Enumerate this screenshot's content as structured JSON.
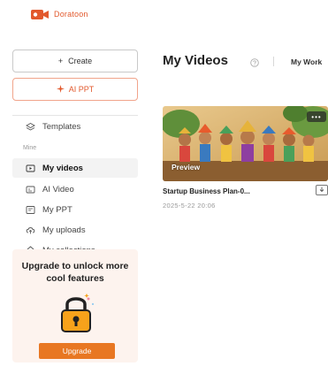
{
  "brand": {
    "name": "Doratoon",
    "color": "#e2592d"
  },
  "sidebar": {
    "create_label": "Create",
    "ai_ppt_label": "AI PPT",
    "section_mine": "Mine",
    "items": [
      {
        "label": "Templates",
        "icon": "template-icon"
      },
      {
        "label": "My videos",
        "icon": "video-icon",
        "active": true
      },
      {
        "label": "AI Video",
        "icon": "ai-video-icon"
      },
      {
        "label": "My PPT",
        "icon": "ppt-icon"
      },
      {
        "label": "My uploads",
        "icon": "upload-icon"
      },
      {
        "label": "My collections",
        "icon": "collection-icon"
      }
    ],
    "upgrade": {
      "title": "Upgrade to unlock more cool features",
      "button_label": "Upgrade",
      "accent": "#e87722"
    }
  },
  "main": {
    "title": "My Videos",
    "tab_works": "My Work",
    "videos": [
      {
        "title": "Startup Business Plan-0...",
        "date": "2025-5-22 20:06",
        "preview_label": "Preview",
        "more_label": "•••"
      }
    ]
  }
}
